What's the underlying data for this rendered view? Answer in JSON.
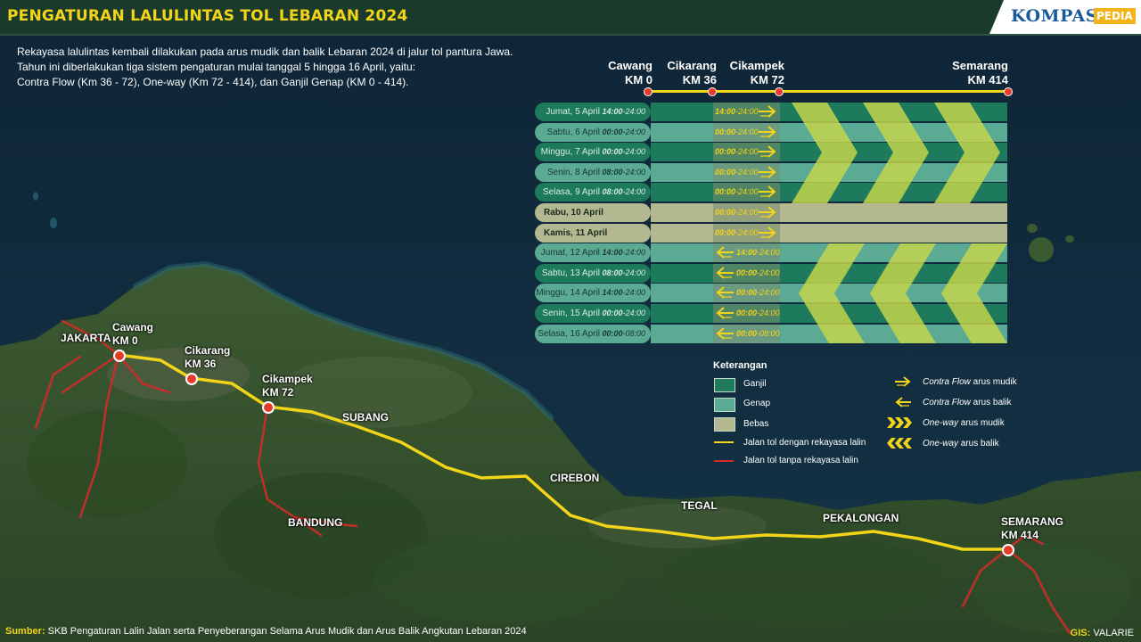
{
  "header": {
    "title": "PENGATURAN LALULINTAS TOL LEBARAN 2024",
    "logo_main": "KOMPAS",
    "logo_sub": "PEDIA"
  },
  "intro": [
    "Rekayasa lalulintas kembali dilakukan pada arus mudik dan balik Lebaran 2024 di jalur tol pantura Jawa.",
    "Tahun ini diberlakukan tiga sistem pengaturan mulai tanggal 5 hingga 16 April, yaitu:",
    "Contra Flow (Km 36 - 72), One-way (Km 72 - 414), dan Ganjil Genap (KM 0 - 414)."
  ],
  "km_markers": [
    {
      "name": "Cawang",
      "km": "KM 0"
    },
    {
      "name": "Cikarang",
      "km": "KM 36"
    },
    {
      "name": "Cikampek",
      "km": "KM 72"
    },
    {
      "name": "Semarang",
      "km": "KM 414"
    }
  ],
  "schedule": [
    {
      "day": "Jumat, 5 April",
      "time_a": "14:00",
      "time_b": "-24:00",
      "mid_a": "14:00",
      "mid_b": "-24:00",
      "type": "ganjil",
      "direction": "mudik"
    },
    {
      "day": "Sabtu, 6 April",
      "time_a": "00:00",
      "time_b": "-24:00",
      "mid_a": "00:00",
      "mid_b": "-24:00",
      "type": "genap",
      "direction": "mudik"
    },
    {
      "day": "Minggu, 7 April",
      "time_a": "00:00",
      "time_b": "-24:00",
      "mid_a": "00:00",
      "mid_b": "-24:00",
      "type": "ganjil",
      "direction": "mudik"
    },
    {
      "day": "Senin, 8 April",
      "time_a": "08:00",
      "time_b": "-24:00",
      "mid_a": "00:00",
      "mid_b": "-24:00",
      "type": "genap",
      "direction": "mudik"
    },
    {
      "day": "Selasa, 9 April",
      "time_a": "08:00",
      "time_b": "-24:00",
      "mid_a": "00:00",
      "mid_b": "-24:00",
      "type": "ganjil",
      "direction": "mudik"
    },
    {
      "day": "Rabu, 10 April",
      "time_a": "",
      "time_b": "",
      "mid_a": "00:00",
      "mid_b": "-24:00",
      "type": "bebas",
      "direction": "mudik"
    },
    {
      "day": "Kamis, 11 April",
      "time_a": "",
      "time_b": "",
      "mid_a": "00:00",
      "mid_b": "-24:00",
      "type": "bebas",
      "direction": "mudik"
    },
    {
      "day": "Jumat, 12 April",
      "time_a": "14:00",
      "time_b": "-24:00",
      "mid_a": "14:00",
      "mid_b": "-24:00",
      "type": "genap",
      "direction": "balik"
    },
    {
      "day": "Sabtu, 13 April",
      "time_a": "08:00",
      "time_b": "-24:00",
      "mid_a": "00:00",
      "mid_b": "-24:00",
      "type": "ganjil",
      "direction": "balik"
    },
    {
      "day": "Minggu, 14 April",
      "time_a": "14:00",
      "time_b": "-24:00",
      "mid_a": "00:00",
      "mid_b": "-24:00",
      "type": "genap",
      "direction": "balik"
    },
    {
      "day": "Senin, 15 April",
      "time_a": "00:00",
      "time_b": "-24:00",
      "mid_a": "00:00",
      "mid_b": "-24:00",
      "type": "ganjil",
      "direction": "balik"
    },
    {
      "day": "Selasa, 16 April",
      "time_a": "00:00",
      "time_b": "-08:00",
      "mid_a": "00:00",
      "mid_b": "-08:00",
      "type": "genap",
      "direction": "balik"
    }
  ],
  "legend": {
    "title": "Keterangan",
    "ganjil": "Ganjil",
    "genap": "Genap",
    "bebas": "Bebas",
    "road_yes": "Jalan tol dengan rekayasa lalin",
    "road_no": "Jalan tol tanpa rekayasa lalin",
    "cf_mudik_i": "Contra Flow",
    "cf_mudik": " arus mudik",
    "cf_balik_i": "Contra Flow",
    "cf_balik": " arus balik",
    "ow_mudik_i": "One-way",
    "ow_mudik": " arus mudik",
    "ow_balik_i": "One-way",
    "ow_balik": " arus balik"
  },
  "colors": {
    "ganjil": "#1e7a5c",
    "genap": "#5aaa94",
    "bebas": "#b4b890",
    "road": "#f2d418",
    "road_red": "#d42a2a",
    "chevron": "#c8d84a",
    "accent": "#f2d418"
  },
  "map_labels": {
    "jakarta": "JAKARTA",
    "cawang_name": "Cawang",
    "cawang_km": "KM 0",
    "cikarang_name": "Cikarang",
    "cikarang_km": "KM 36",
    "cikampek_name": "Cikampek",
    "cikampek_km": "KM 72",
    "subang": "SUBANG",
    "bandung": "BANDUNG",
    "cirebon": "CIREBON",
    "tegal": "TEGAL",
    "pekalongan": "PEKALONGAN",
    "semarang_name": "SEMARANG",
    "semarang_km": "KM 414"
  },
  "footer": {
    "source_label": "Sumber:",
    "source": " SKB Pengaturan Lalin Jalan serta Penyeberangan Selama Arus Mudik dan Arus Balik Angkutan Lebaran 2024",
    "gis_label": "GIS:",
    "gis": " VALARIE"
  }
}
